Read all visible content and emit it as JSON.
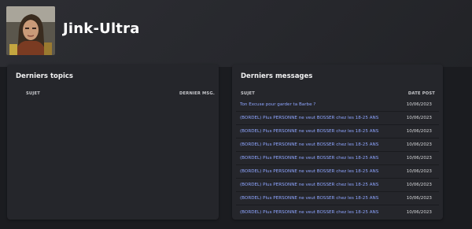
{
  "profile": {
    "username": "Jink-Ultra",
    "avatar_icon": "user-avatar-photo"
  },
  "topics_panel": {
    "title": "Derniers topics",
    "col_subject": "SUJET",
    "col_last_msg": "DERNIER MSG."
  },
  "messages_panel": {
    "title": "Derniers messages",
    "col_subject": "SUJET",
    "col_date": "DATE POST",
    "rows": [
      {
        "subject": "Ton Excuse pour garder ta Barbe ?",
        "date": "10/06/2023"
      },
      {
        "subject": "(BORDEL) Plus PERSONNE ne veut BOSSER chez les 18-25 ANS",
        "date": "10/06/2023"
      },
      {
        "subject": "(BORDEL) Plus PERSONNE ne veut BOSSER chez les 18-25 ANS",
        "date": "10/06/2023"
      },
      {
        "subject": "(BORDEL) Plus PERSONNE ne veut BOSSER chez les 18-25 ANS",
        "date": "10/06/2023"
      },
      {
        "subject": "(BORDEL) Plus PERSONNE ne veut BOSSER chez les 18-25 ANS",
        "date": "10/06/2023"
      },
      {
        "subject": "(BORDEL) Plus PERSONNE ne veut BOSSER chez les 18-25 ANS",
        "date": "10/06/2023"
      },
      {
        "subject": "(BORDEL) Plus PERSONNE ne veut BOSSER chez les 18-25 ANS",
        "date": "10/06/2023"
      },
      {
        "subject": "(BORDEL) Plus PERSONNE ne veut BOSSER chez les 18-25 ANS",
        "date": "10/06/2023"
      },
      {
        "subject": "(BORDEL) Plus PERSONNE ne veut BOSSER chez les 18-25 ANS",
        "date": "10/06/2023"
      }
    ]
  },
  "colors": {
    "link": "#8ea5ff",
    "card_bg": "#25262b",
    "page_bg": "#1b1c20"
  }
}
